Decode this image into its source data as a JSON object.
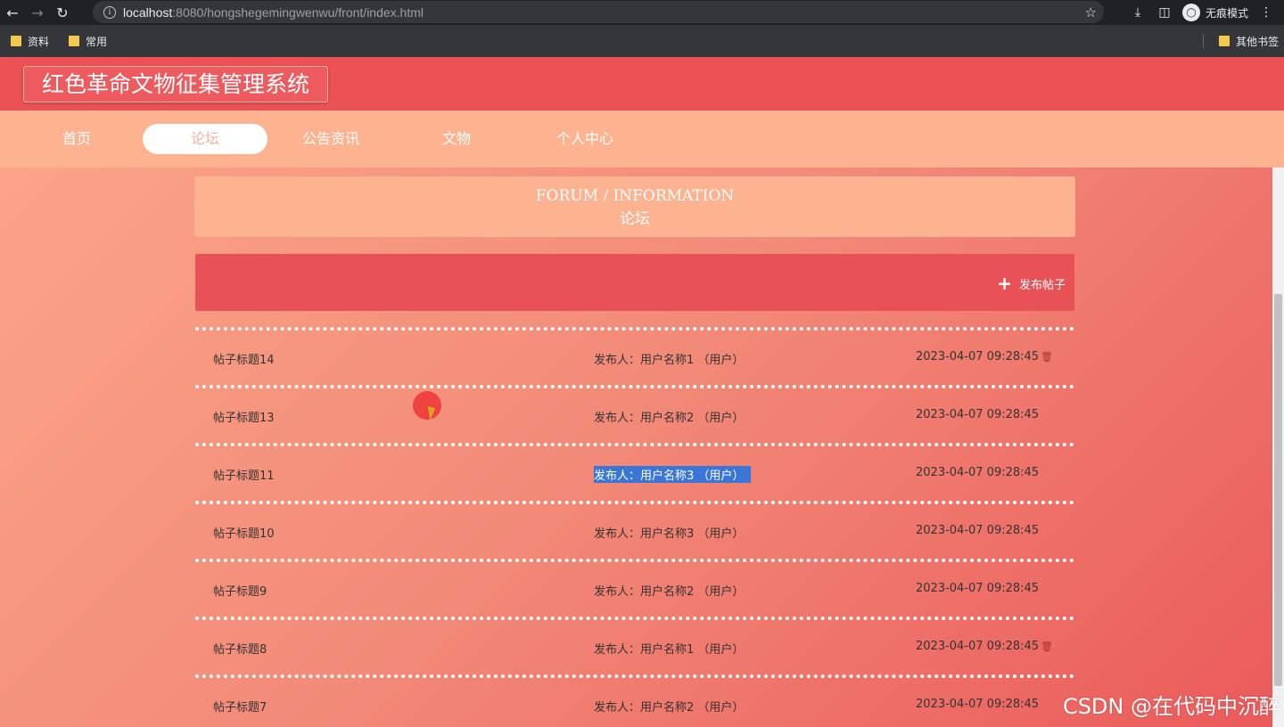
{
  "browser": {
    "url_host": "localhost",
    "url_path": ":8080/hongshegemingwenwu/front/index.html",
    "incognito_label": "无痕模式",
    "bookmarks": [
      {
        "label": "资料"
      },
      {
        "label": "常用"
      }
    ],
    "other_bookmarks": "其他书签"
  },
  "site": {
    "title": "红色革命文物征集管理系统"
  },
  "nav": {
    "items": [
      {
        "label": "首页"
      },
      {
        "label": "论坛",
        "active": true
      },
      {
        "label": "公告资讯"
      },
      {
        "label": "文物"
      },
      {
        "label": "个人中心"
      }
    ]
  },
  "panel": {
    "title_en": "FORUM / INFORMATION",
    "title_cn": "论坛"
  },
  "actions": {
    "post_label": "发布帖子"
  },
  "posts": [
    {
      "title": "帖子标题14",
      "author": "发布人：用户名称1 （用户）",
      "time": "2023-04-07 09:28:45",
      "deletable": true
    },
    {
      "title": "帖子标题13",
      "author": "发布人：用户名称2 （用户）",
      "time": "2023-04-07 09:28:45",
      "deletable": false
    },
    {
      "title": "帖子标题11",
      "author": "发布人：用户名称3 （用户）",
      "time": "2023-04-07 09:28:45",
      "deletable": false,
      "selected": true
    },
    {
      "title": "帖子标题10",
      "author": "发布人：用户名称3 （用户）",
      "time": "2023-04-07 09:28:45",
      "deletable": false
    },
    {
      "title": "帖子标题9",
      "author": "发布人：用户名称2 （用户）",
      "time": "2023-04-07 09:28:45",
      "deletable": false
    },
    {
      "title": "帖子标题8",
      "author": "发布人：用户名称1 （用户）",
      "time": "2023-04-07 09:28:45",
      "deletable": true
    },
    {
      "title": "帖子标题7",
      "author": "发布人：用户名称2 （用户）",
      "time": "2023-04-07 09:28:45",
      "deletable": false
    }
  ],
  "watermark": "CSDN @在代码中沉醉"
}
